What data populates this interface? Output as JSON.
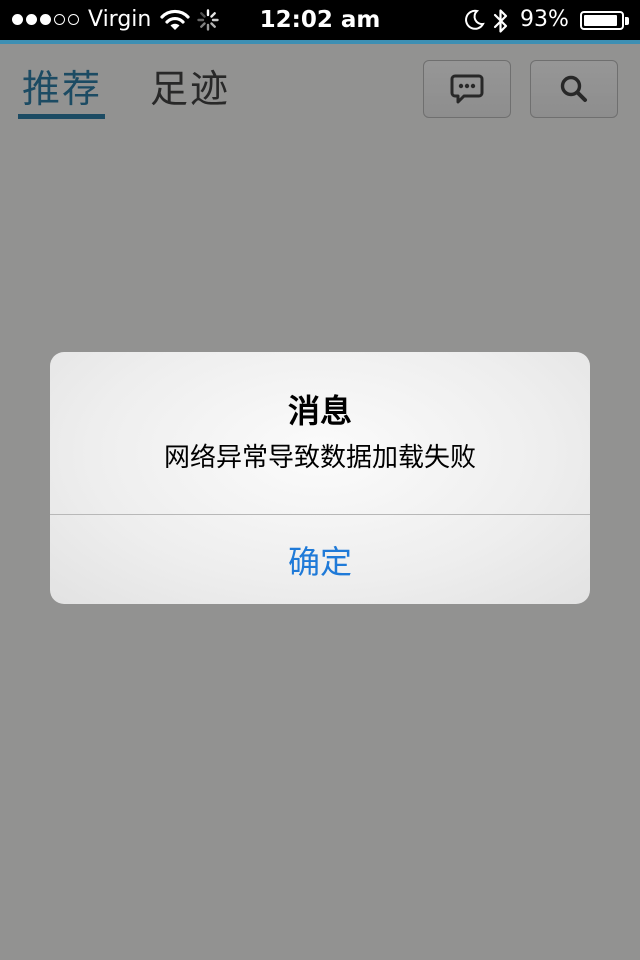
{
  "status_bar": {
    "carrier": "Virgin",
    "signal_strength": 3,
    "signal_total": 5,
    "time": "12:02 am",
    "battery_percent": "93%",
    "battery_level": 0.93,
    "icons": [
      "wifi-icon",
      "activity-spinner-icon",
      "moon-icon",
      "bluetooth-icon",
      "battery-icon"
    ],
    "background_color": "#000000",
    "accent_color": "#3d8fb3"
  },
  "header": {
    "tabs": [
      {
        "label": "推荐",
        "active": true
      },
      {
        "label": "足迹",
        "active": false
      }
    ],
    "buttons": [
      {
        "icon": "message-icon"
      },
      {
        "icon": "search-icon"
      }
    ],
    "active_color": "#2f7ea6"
  },
  "alert": {
    "title": "消息",
    "message": "网络异常导致数据加载失败",
    "confirm_label": "确定",
    "button_color": "#1f7ad8"
  }
}
